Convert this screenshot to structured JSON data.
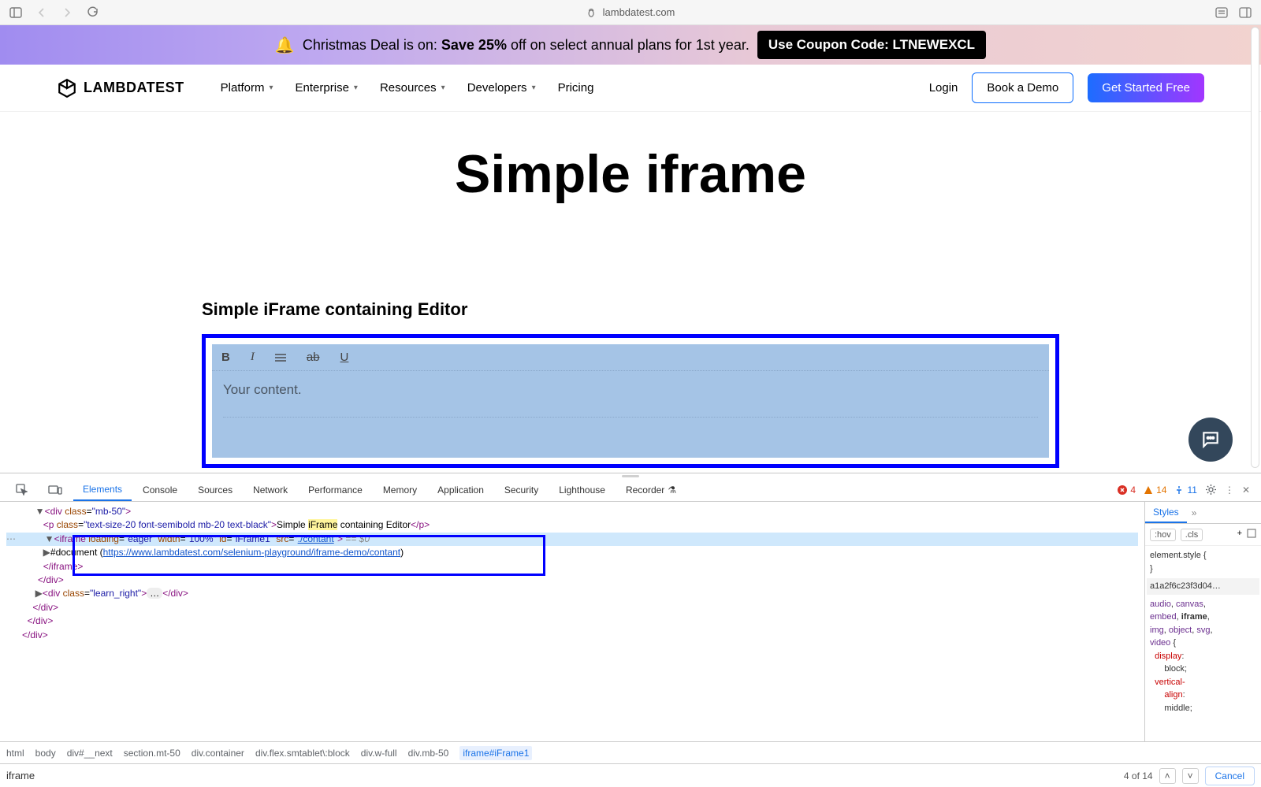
{
  "chrome": {
    "url": "lambdatest.com"
  },
  "promo": {
    "text_before": "Christmas Deal is on: ",
    "bold": "Save 25% ",
    "text_after": "off on select annual plans for 1st year.",
    "coupon": "Use Coupon Code: LTNEWEXCL"
  },
  "brand": "LAMBDATEST",
  "nav": {
    "items": [
      "Platform",
      "Enterprise",
      "Resources",
      "Developers",
      "Pricing"
    ],
    "login": "Login",
    "demo": "Book a Demo",
    "cta": "Get Started Free"
  },
  "page": {
    "title": "Simple iframe",
    "editor_label": "Simple iFrame containing Editor",
    "placeholder": "Your content."
  },
  "devtools": {
    "tabs": [
      "Elements",
      "Console",
      "Sources",
      "Network",
      "Performance",
      "Memory",
      "Application",
      "Security",
      "Lighthouse",
      "Recorder"
    ],
    "recorder_icon": "⚗",
    "errors": "4",
    "warnings": "14",
    "infos": "11",
    "styles_tab": "Styles",
    "hov": ":hov",
    "cls": ".cls",
    "element_style": "element.style {",
    "close_brace": "}",
    "hash": "a1a2f6c23f3d04…",
    "css_selectors": "audio, canvas, embed, iframe, img, object, svg, video {",
    "css_prop1": "display",
    "css_val1": "block",
    "css_prop2": "vertical-align",
    "css_val2": "middle",
    "dom": {
      "l1": "<div class=\"mb-50\">",
      "l2_before": "<p class=\"text-size-20 font-semibold mb-20 text-black\">Simple ",
      "l2_hl": "iFrame",
      "l2_after": " containing Editor</p>",
      "l3": "<iframe loading=\"eager\" width=\"100%\" id=\"iFrame1\" src=\"",
      "l3_link": "./contant",
      "l3_close": "\">",
      "l3_eq": " == $0",
      "l4_a": "#document (",
      "l4_link": "https://www.lambdatest.com/selenium-playground/iframe-demo/contant",
      "l4_c": ")",
      "l5": "</iframe>",
      "l6": "</div>",
      "l7": "<div class=\"learn_right\">",
      "l7_ell": "…",
      "l7_end": "</div>",
      "l8": "</div>",
      "l9": "</div>",
      "l10": "</div>"
    },
    "breadcrumb": [
      "html",
      "body",
      "div#__next",
      "section.mt-50",
      "div.container",
      "div.flex.smtablet\\:block",
      "div.w-full",
      "div.mb-50",
      "iframe#iFrame1"
    ],
    "search": {
      "value": "iframe",
      "count": "4 of 14",
      "cancel": "Cancel"
    }
  }
}
